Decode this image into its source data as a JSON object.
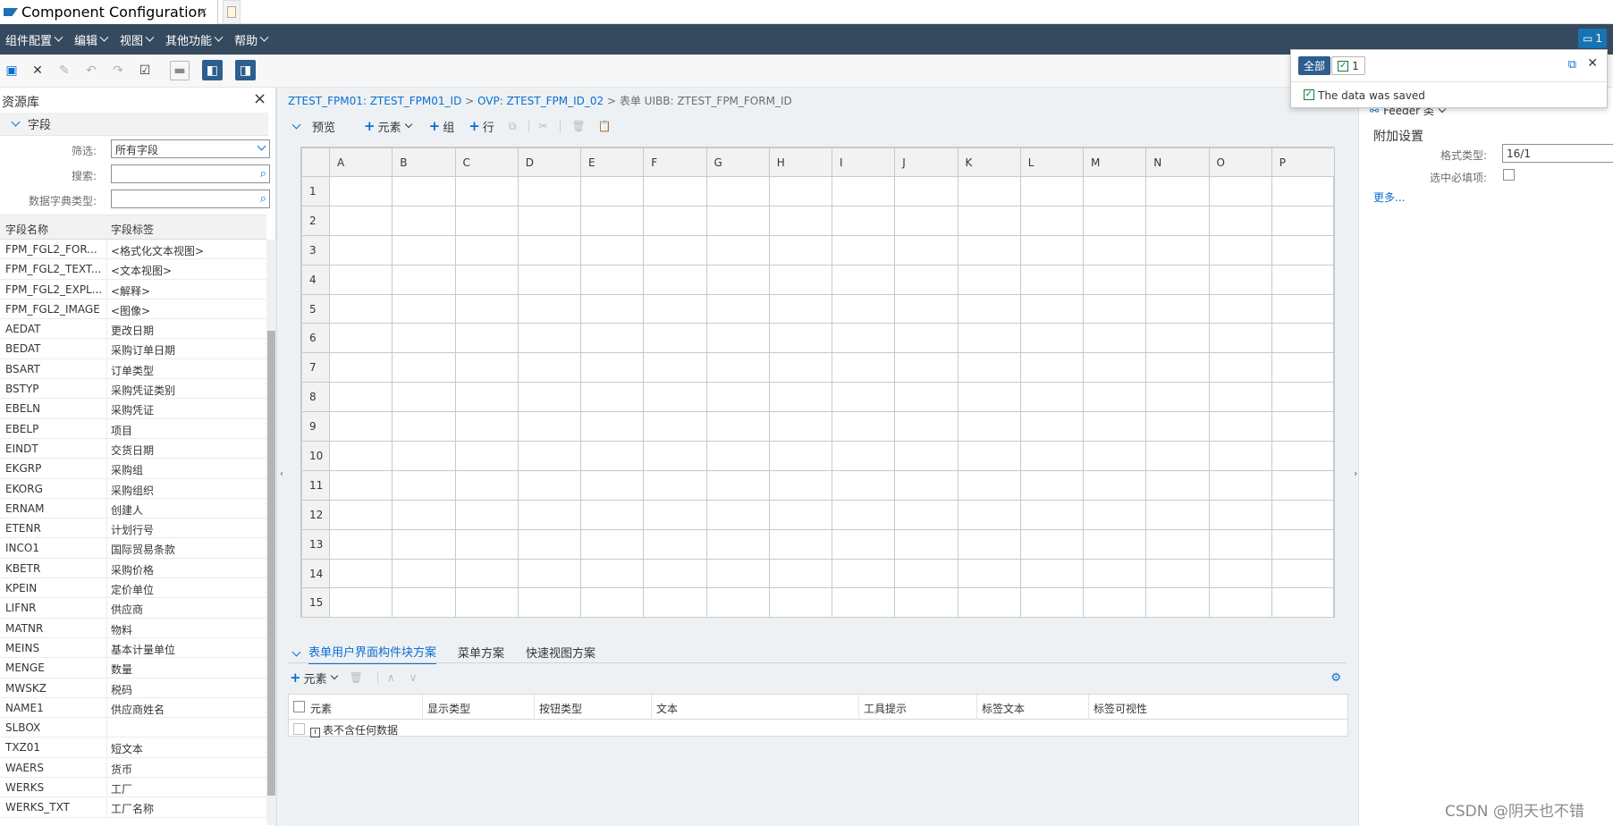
{
  "window": {
    "title": "Component Configuration"
  },
  "menu": [
    "组件配置",
    "编辑",
    "视图",
    "其他功能",
    "帮助"
  ],
  "message_button": "1",
  "popup": {
    "all_label": "全部",
    "count": "1",
    "message": "The data was saved"
  },
  "left_panel": {
    "title": "资源库",
    "section": "字段",
    "filter_label": "筛选:",
    "filter_value": "所有字段",
    "search_label": "搜索:",
    "ddic_label": "数据字典类型:",
    "col_name": "字段名称",
    "col_label": "字段标签",
    "fields": [
      [
        "FPM_FGL2_FOR...",
        "<格式化文本视图>"
      ],
      [
        "FPM_FGL2_TEXT...",
        "<文本视图>"
      ],
      [
        "FPM_FGL2_EXPL...",
        "<解释>"
      ],
      [
        "FPM_FGL2_IMAGE",
        "<图像>"
      ],
      [
        "AEDAT",
        "更改日期"
      ],
      [
        "BEDAT",
        "采购订单日期"
      ],
      [
        "BSART",
        "订单类型"
      ],
      [
        "BSTYP",
        "采购凭证类别"
      ],
      [
        "EBELN",
        "采购凭证"
      ],
      [
        "EBELP",
        "项目"
      ],
      [
        "EINDT",
        "交货日期"
      ],
      [
        "EKGRP",
        "采购组"
      ],
      [
        "EKORG",
        "采购组织"
      ],
      [
        "ERNAM",
        "创建人"
      ],
      [
        "ETENR",
        "计划行号"
      ],
      [
        "INCO1",
        "国际贸易条款"
      ],
      [
        "KBETR",
        "采购价格"
      ],
      [
        "KPEIN",
        "定价单位"
      ],
      [
        "LIFNR",
        "供应商"
      ],
      [
        "MATNR",
        "物料"
      ],
      [
        "MEINS",
        "基本计量单位"
      ],
      [
        "MENGE",
        "数量"
      ],
      [
        "MWSKZ",
        "税码"
      ],
      [
        "NAME1",
        "供应商姓名"
      ],
      [
        "SLBOX",
        ""
      ],
      [
        "TXZ01",
        "短文本"
      ],
      [
        "WAERS",
        "货币"
      ],
      [
        "WERKS",
        "工厂"
      ],
      [
        "WERKS_TXT",
        "工厂名称"
      ]
    ]
  },
  "breadcrumb": {
    "p1": "ZTEST_FPM01: ZTEST_FPM01_ID",
    "sep1": " > ",
    "p2": "OVP: ZTEST_FPM_ID_02",
    "p3": " > 表单 UIBB: ZTEST_FPM_FORM_ID"
  },
  "preview": {
    "title": "预览",
    "add_element": "元素",
    "add_group": "组",
    "add_row": "行"
  },
  "grid": {
    "columns": [
      "A",
      "B",
      "C",
      "D",
      "E",
      "F",
      "G",
      "H",
      "I",
      "J",
      "K",
      "L",
      "M",
      "N",
      "O",
      "P"
    ],
    "rows": [
      "1",
      "2",
      "3",
      "4",
      "5",
      "6",
      "7",
      "8",
      "9",
      "10",
      "11",
      "12",
      "13",
      "14",
      "15"
    ]
  },
  "lower": {
    "tabs": [
      "表单用户界面构件块方案",
      "菜单方案",
      "快速视图方案"
    ],
    "add_element": "元素",
    "columns": [
      "元素",
      "显示类型",
      "按钮类型",
      "文本",
      "工具提示",
      "标签文本",
      "标签可视性"
    ],
    "empty_text": "表不含任何数据"
  },
  "right_panel": {
    "feeder": "Feeder 类",
    "section": "附加设置",
    "format_label": "格式类型:",
    "format_value": "16/1",
    "required_label": "选中必填项:",
    "more": "更多..."
  },
  "watermark": "CSDN @阴天也不错"
}
